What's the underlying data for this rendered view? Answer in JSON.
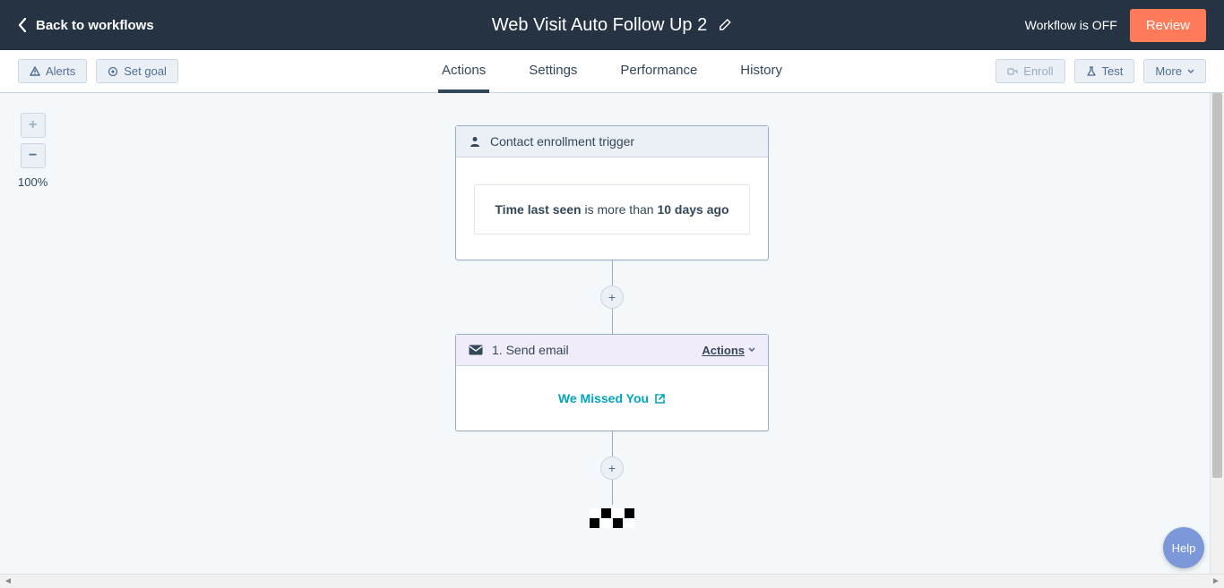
{
  "header": {
    "back_label": "Back to workflows",
    "title": "Web Visit Auto Follow Up 2",
    "status": "Workflow is OFF",
    "review_label": "Review"
  },
  "toolbar": {
    "alerts_label": "Alerts",
    "set_goal_label": "Set goal",
    "enroll_label": "Enroll",
    "test_label": "Test",
    "more_label": "More"
  },
  "tabs": {
    "actions": "Actions",
    "settings": "Settings",
    "performance": "Performance",
    "history": "History"
  },
  "zoom": {
    "percent": "100%"
  },
  "trigger": {
    "header": "Contact enrollment trigger",
    "prop": "Time last seen",
    "op": " is more than ",
    "val": "10 days ago"
  },
  "send_email": {
    "header": "1. Send email",
    "actions_label": "Actions",
    "email_name": "We Missed You"
  },
  "help": {
    "label": "Help"
  }
}
